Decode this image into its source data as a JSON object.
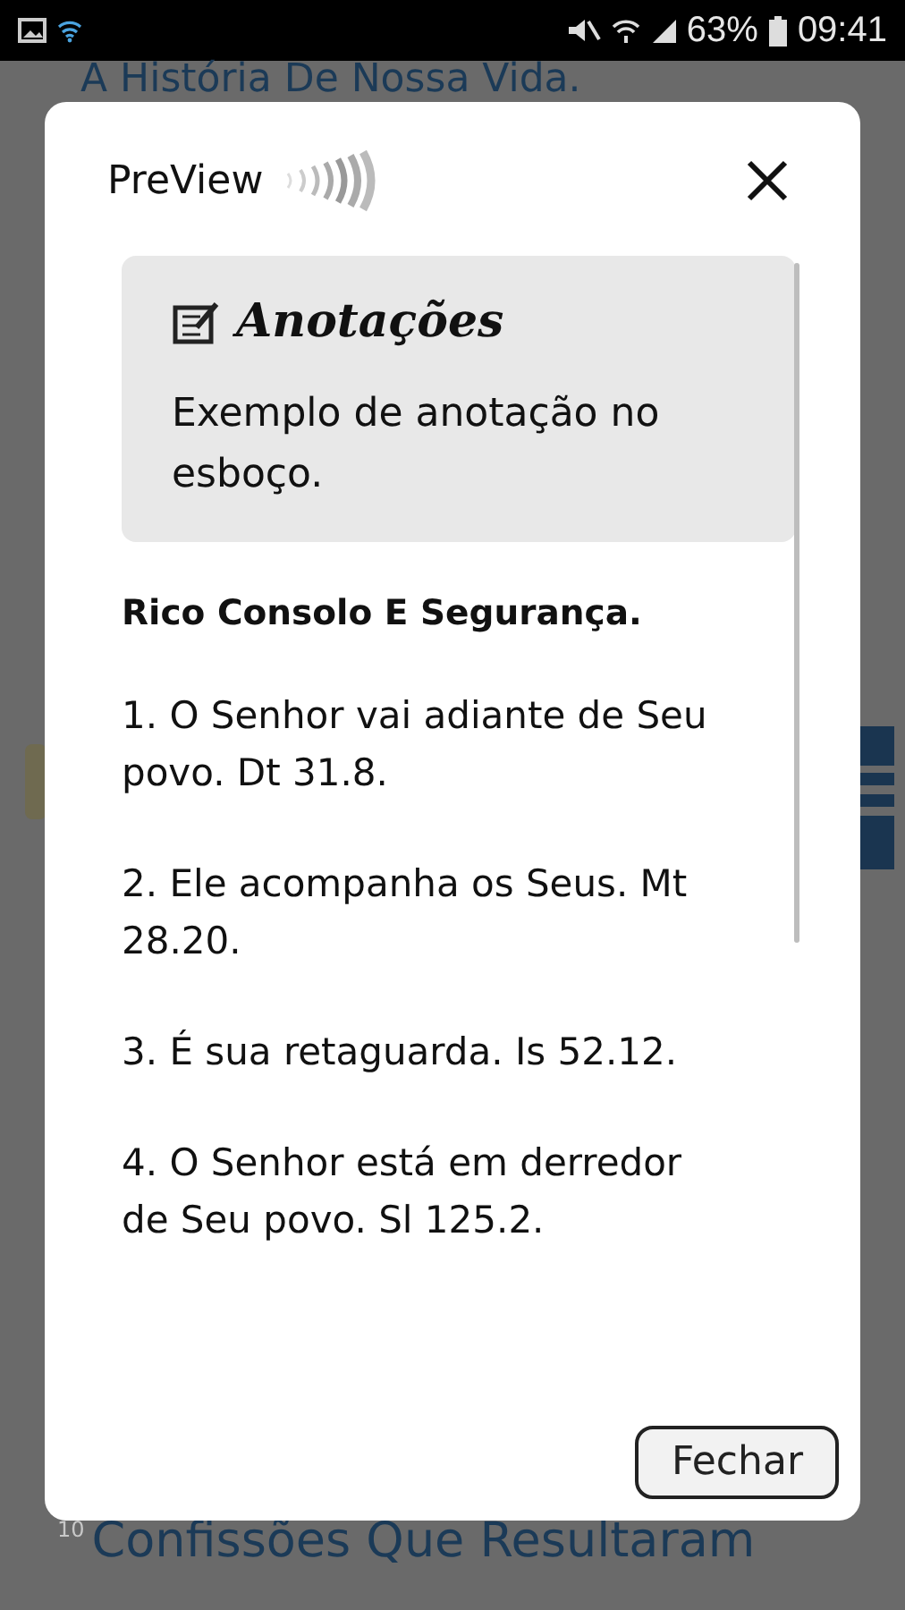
{
  "status_bar": {
    "battery": "63%",
    "time": "09:41"
  },
  "background": {
    "heading_top": "A História De Nossa Vida.",
    "item_number": "10",
    "item_title": "Confissões Que Resultaram"
  },
  "dialog": {
    "title": "PreView",
    "note": {
      "heading": "Anotações",
      "text": "Exemplo de anotação no esboço."
    },
    "outline_title": "Rico Consolo E Segurança.",
    "points": [
      "1. O Senhor vai adiante de Seu povo. Dt 31.8.",
      "2. Ele acompanha os Seus. Mt 28.20.",
      "3. É sua retaguarda. Is 52.12.",
      "4. O Senhor está em derredor de Seu povo. Sl 125.2."
    ],
    "close_button": "Fechar"
  }
}
